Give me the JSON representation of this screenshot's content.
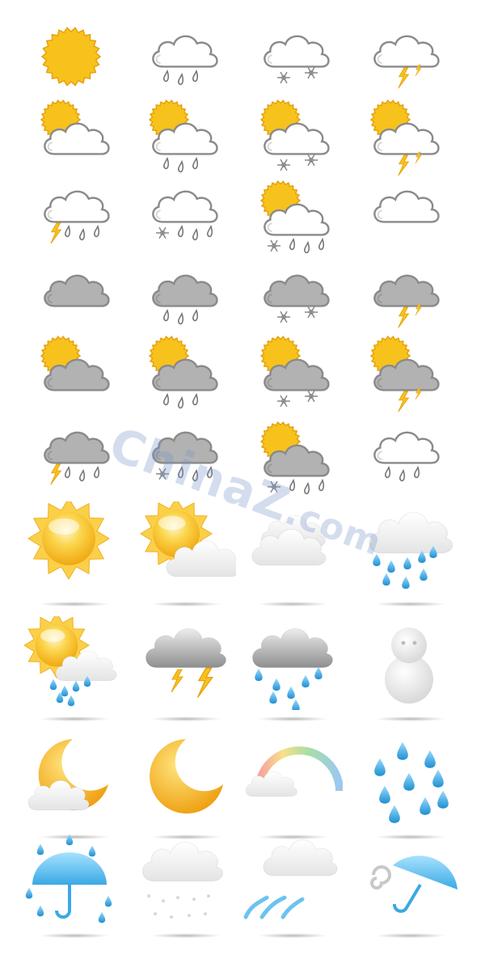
{
  "watermark": {
    "name": "ChinaZ",
    "suffix": ".com"
  },
  "colors": {
    "sun": "#F7C21C",
    "sun_edge": "#E8A10B",
    "cloud_white": "#FFFFFF",
    "cloud_outline": "#8A8A8A",
    "cloud_grey": "#B2B2B2",
    "rain_drop": "#3FA3DC",
    "umbrella": "#6BC3F0",
    "moon": "#F2B21A"
  },
  "flat_icons": [
    [
      "sun-icon",
      "cloud-rain-icon",
      "cloud-snow-icon",
      "cloud-thunder-icon"
    ],
    [
      "sun-cloud-icon",
      "sun-cloud-rain-icon",
      "sun-cloud-snow-icon",
      "sun-cloud-thunder-icon"
    ],
    [
      "cloud-thunder-rain-icon",
      "cloud-snow-rain-icon",
      "sun-cloud-snow-rain-icon",
      "cloud-icon"
    ],
    [
      "grey-cloud-icon",
      "grey-cloud-rain-icon",
      "grey-cloud-snow-icon",
      "grey-cloud-thunder-icon"
    ],
    [
      "sun-grey-cloud-icon",
      "sun-grey-cloud-rain-icon",
      "sun-grey-cloud-snow-icon",
      "sun-grey-cloud-thunder-icon"
    ],
    [
      "grey-cloud-thunder-rain-icon",
      "grey-cloud-snow-rain-icon",
      "sun-grey-cloud-snow-rain-icon",
      "cloud-rain-icon"
    ]
  ],
  "glossy_icons": [
    [
      "glossy-sun-icon",
      "glossy-sun-cloud-icon",
      "glossy-cloud-icon",
      "glossy-cloud-rain-icon"
    ],
    [
      "glossy-sun-cloud-rain-icon",
      "glossy-thunder-cloud-icon",
      "glossy-grey-cloud-rain-icon",
      "snowman-icon"
    ],
    [
      "moon-cloud-icon",
      "crescent-moon-icon",
      "rainbow-cloud-icon",
      "raindrops-icon"
    ],
    [
      "umbrella-rain-icon",
      "cloud-snow-icon",
      "cloud-wind-icon",
      "wind-umbrella-icon"
    ]
  ]
}
